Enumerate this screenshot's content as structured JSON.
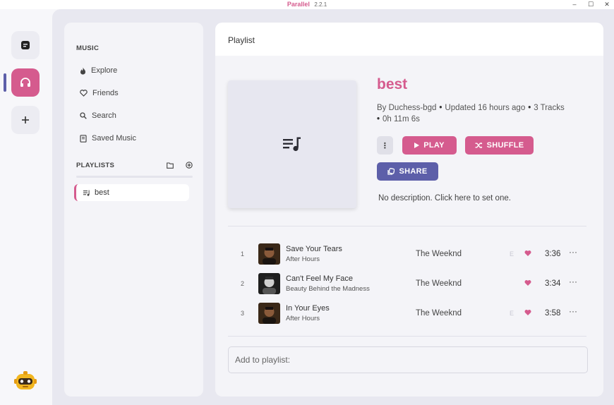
{
  "window": {
    "app_name": "Parallel",
    "version": "2.2.1",
    "minimize": "–",
    "maximize": "☐",
    "close": "✕"
  },
  "colors": {
    "accent": "#d55b8e",
    "secondary": "#5d5fa9"
  },
  "sidebar": {
    "music_heading": "MUSIC",
    "items": [
      {
        "label": "Explore",
        "icon": "flame-icon"
      },
      {
        "label": "Friends",
        "icon": "heart-icon"
      },
      {
        "label": "Search",
        "icon": "search-icon"
      },
      {
        "label": "Saved Music",
        "icon": "saved-music-icon"
      }
    ],
    "playlists_heading": "PLAYLISTS",
    "playlists": [
      {
        "label": "best"
      }
    ]
  },
  "content": {
    "header": "Playlist",
    "playlist": {
      "title": "best",
      "owner": "By Duchess-bgd",
      "updated": "Updated 16 hours ago",
      "tracks_count": "3 Tracks",
      "duration": "0h 11m 6s",
      "description": "No description. Click here to set one."
    },
    "buttons": {
      "play": "PLAY",
      "shuffle": "SHUFFLE",
      "share": "SHARE",
      "more": "⋮"
    },
    "tracks": [
      {
        "num": "1",
        "title": "Save Your Tears",
        "album": "After Hours",
        "artist": "The Weeknd",
        "explicit": "E",
        "duration": "3:36",
        "more": "···"
      },
      {
        "num": "2",
        "title": "Can't Feel My Face",
        "album": "Beauty Behind the Madness",
        "artist": "The Weeknd",
        "explicit": "",
        "duration": "3:34",
        "more": "···"
      },
      {
        "num": "3",
        "title": "In Your Eyes",
        "album": "After Hours",
        "artist": "The Weeknd",
        "explicit": "E",
        "duration": "3:58",
        "more": "···"
      }
    ],
    "add_placeholder": "Add to playlist:"
  }
}
